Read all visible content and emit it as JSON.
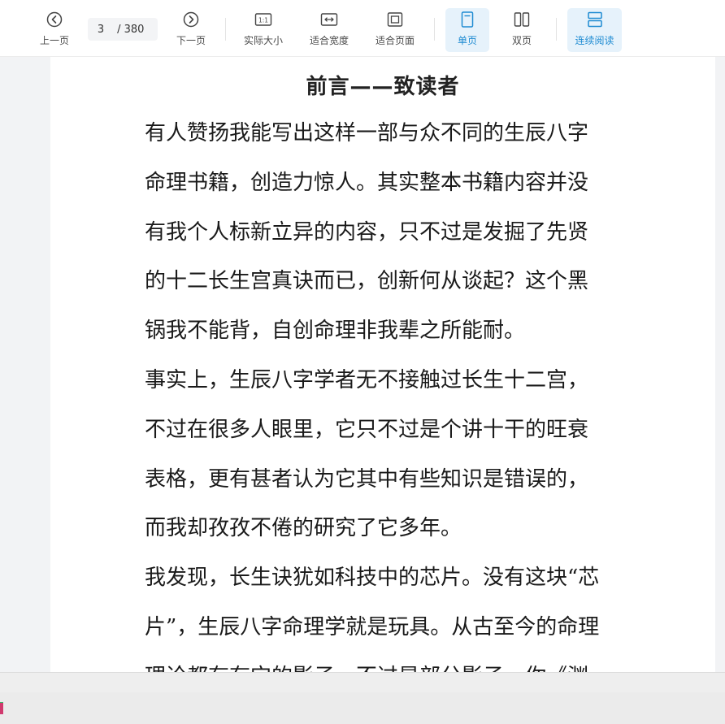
{
  "toolbar": {
    "prev_label": "上一页",
    "next_label": "下一页",
    "page_current": "3",
    "page_total": " / 380",
    "actual_size_label": "实际大小",
    "fit_width_label": "适合宽度",
    "fit_page_label": "适合页面",
    "single_page_label": "单页",
    "double_page_label": "双页",
    "continuous_label": "连续阅读",
    "actual_size_icon_text": "1:1",
    "accent_color": "#1e8bd2",
    "active_bg": "#e6f2fb"
  },
  "document": {
    "title": "前言——致读者",
    "lines": [
      "有人赞扬我能写出这样一部与众不同的生辰八字",
      "命理书籍，创造力惊人。其实整本书籍内容并没",
      "有我个人标新立异的内容，只不过是发掘了先贤",
      "的十二长生宫真诀而已，创新何从谈起？这个黑",
      "锅我不能背，自创命理非我辈之所能耐。",
      "事实上，生辰八字学者无不接触过长生十二宫，",
      "不过在很多人眼里，它只不过是个讲十干的旺衰",
      "表格，更有甚者认为它其中有些知识是错误的，",
      "而我却孜孜不倦的研究了它多年。",
      "我发现，长生诀犹如科技中的芯片。没有这块“芯",
      "片”，生辰八字命理学就是玩具。从古至今的命理",
      "理论都有有它的影子，不过是部分影子，你《渊"
    ]
  }
}
